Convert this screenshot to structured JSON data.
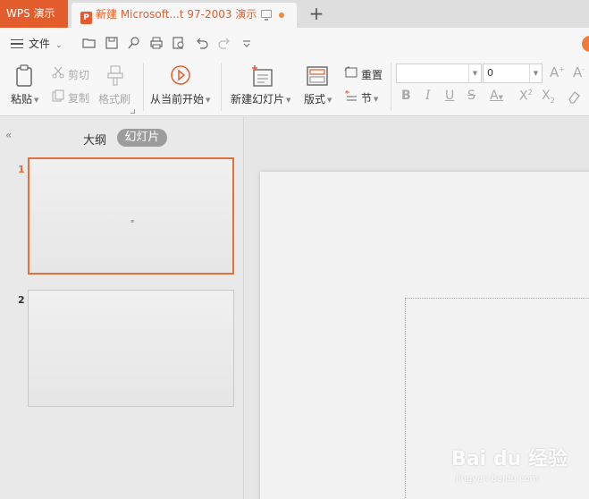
{
  "titlebar": {
    "app_name": "WPS 演示",
    "doc_tab": "新建 Microsoft...t 97-2003 演示",
    "new_tab": "+"
  },
  "quickbar": {
    "file_menu": "文件"
  },
  "ribbon": {
    "paste": "粘贴",
    "cut": "剪切",
    "copy": "复制",
    "format_painter": "格式刷",
    "from_current": "从当前开始",
    "new_slide": "新建幻灯片",
    "layout": "版式",
    "reset": "重置",
    "section": "节",
    "font_size": "0"
  },
  "left_panel": {
    "tab_outline": "大纲",
    "tab_slides": "幻灯片",
    "slides": [
      {
        "num": "1"
      },
      {
        "num": "2"
      }
    ]
  },
  "watermark": {
    "brand": "Bai du 经验",
    "url": "jingyan.baidu.com"
  },
  "colors": {
    "accent": "#e35c2b",
    "tab_text": "#e0622f"
  }
}
